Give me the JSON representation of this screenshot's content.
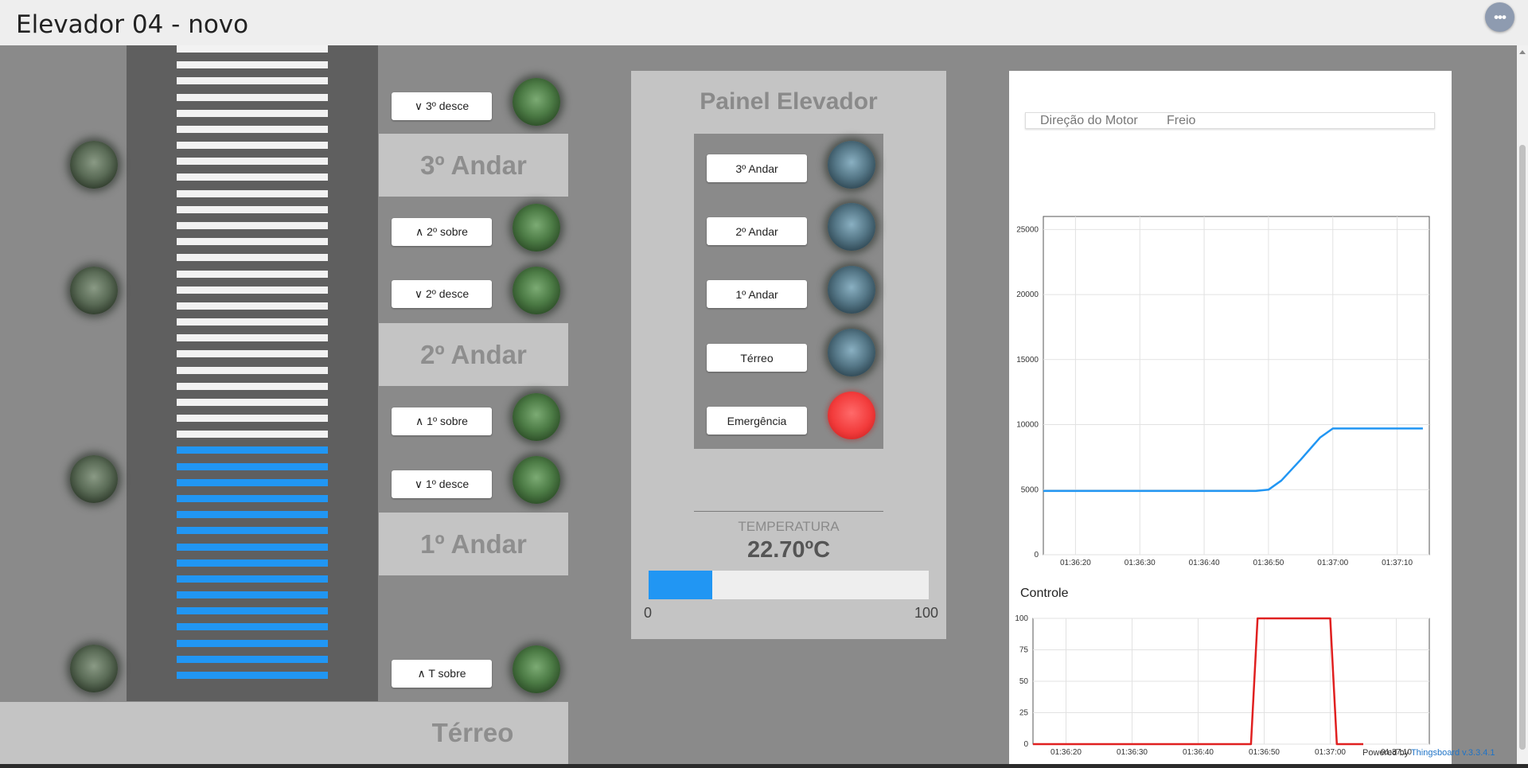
{
  "header": {
    "title": "Elevador 04 - novo",
    "menu_glyph": "•••",
    "menu_icon": "more-horizontal-icon"
  },
  "shaft": {
    "stripe_count": 40,
    "blue_stripe_count": 15,
    "stripe_color": "#f2f2f2",
    "blue_color": "#2196f3"
  },
  "hall": {
    "floors": {
      "f3": "3º Andar",
      "f2": "2º Andar",
      "f1": "1º Andar",
      "ground": "Térreo"
    },
    "buttons": {
      "f3_down": "∨ 3º desce",
      "f2_up": "∧ 2º sobre",
      "f2_down": "∨ 2º desce",
      "f1_up": "∧ 1º sobre",
      "f1_down": "∨ 1º desce",
      "t_up": "∧ T sobre"
    }
  },
  "panel": {
    "title": "Painel Elevador",
    "buttons": {
      "f3": "3º Andar",
      "f2": "2º Andar",
      "f1": "1º Andar",
      "ground": "Térreo",
      "emergency": "Emergência"
    },
    "temperature": {
      "label": "TEMPERATURA",
      "value": "22.70ºC",
      "level": 22.7,
      "min": "0",
      "max": "100"
    }
  },
  "chart_legend": {
    "item1": "Direção do Motor",
    "item2": "Freio"
  },
  "chart_data": [
    {
      "type": "line",
      "series": [
        {
          "color": "#2196f3",
          "x": [
            "01:36:15",
            "01:36:20",
            "01:36:30",
            "01:36:40",
            "01:36:48",
            "01:36:50",
            "01:36:52",
            "01:36:55",
            "01:36:58",
            "01:37:00",
            "01:37:05",
            "01:37:10",
            "01:37:14"
          ],
          "values": [
            4900,
            4900,
            4900,
            4900,
            4900,
            5000,
            5700,
            7300,
            9000,
            9700,
            9700,
            9700,
            9700
          ]
        }
      ],
      "x_ticks": [
        "01:36:20",
        "01:36:30",
        "01:36:40",
        "01:36:50",
        "01:37:00",
        "01:37:10"
      ],
      "y_ticks": [
        "0",
        "5000",
        "10000",
        "15000",
        "20000",
        "25000"
      ],
      "ylim": [
        0,
        26000
      ],
      "grid": true
    },
    {
      "type": "line",
      "title": "Controle",
      "series": [
        {
          "color": "#e02020",
          "x": [
            "01:36:15",
            "01:36:48",
            "01:36:49",
            "01:37:00",
            "01:37:01",
            "01:37:05"
          ],
          "values": [
            0,
            0,
            100,
            100,
            0,
            0
          ]
        }
      ],
      "x_ticks": [
        "01:36:20",
        "01:36:30",
        "01:36:40",
        "01:36:50",
        "01:37:00",
        "01:37:10"
      ],
      "y_ticks": [
        "0",
        "25",
        "50",
        "75",
        "100"
      ],
      "ylim": [
        0,
        100
      ],
      "grid": true
    }
  ],
  "footer": {
    "powered": "Powered by",
    "brand": "Thingsboard v.3.3.4.1"
  }
}
